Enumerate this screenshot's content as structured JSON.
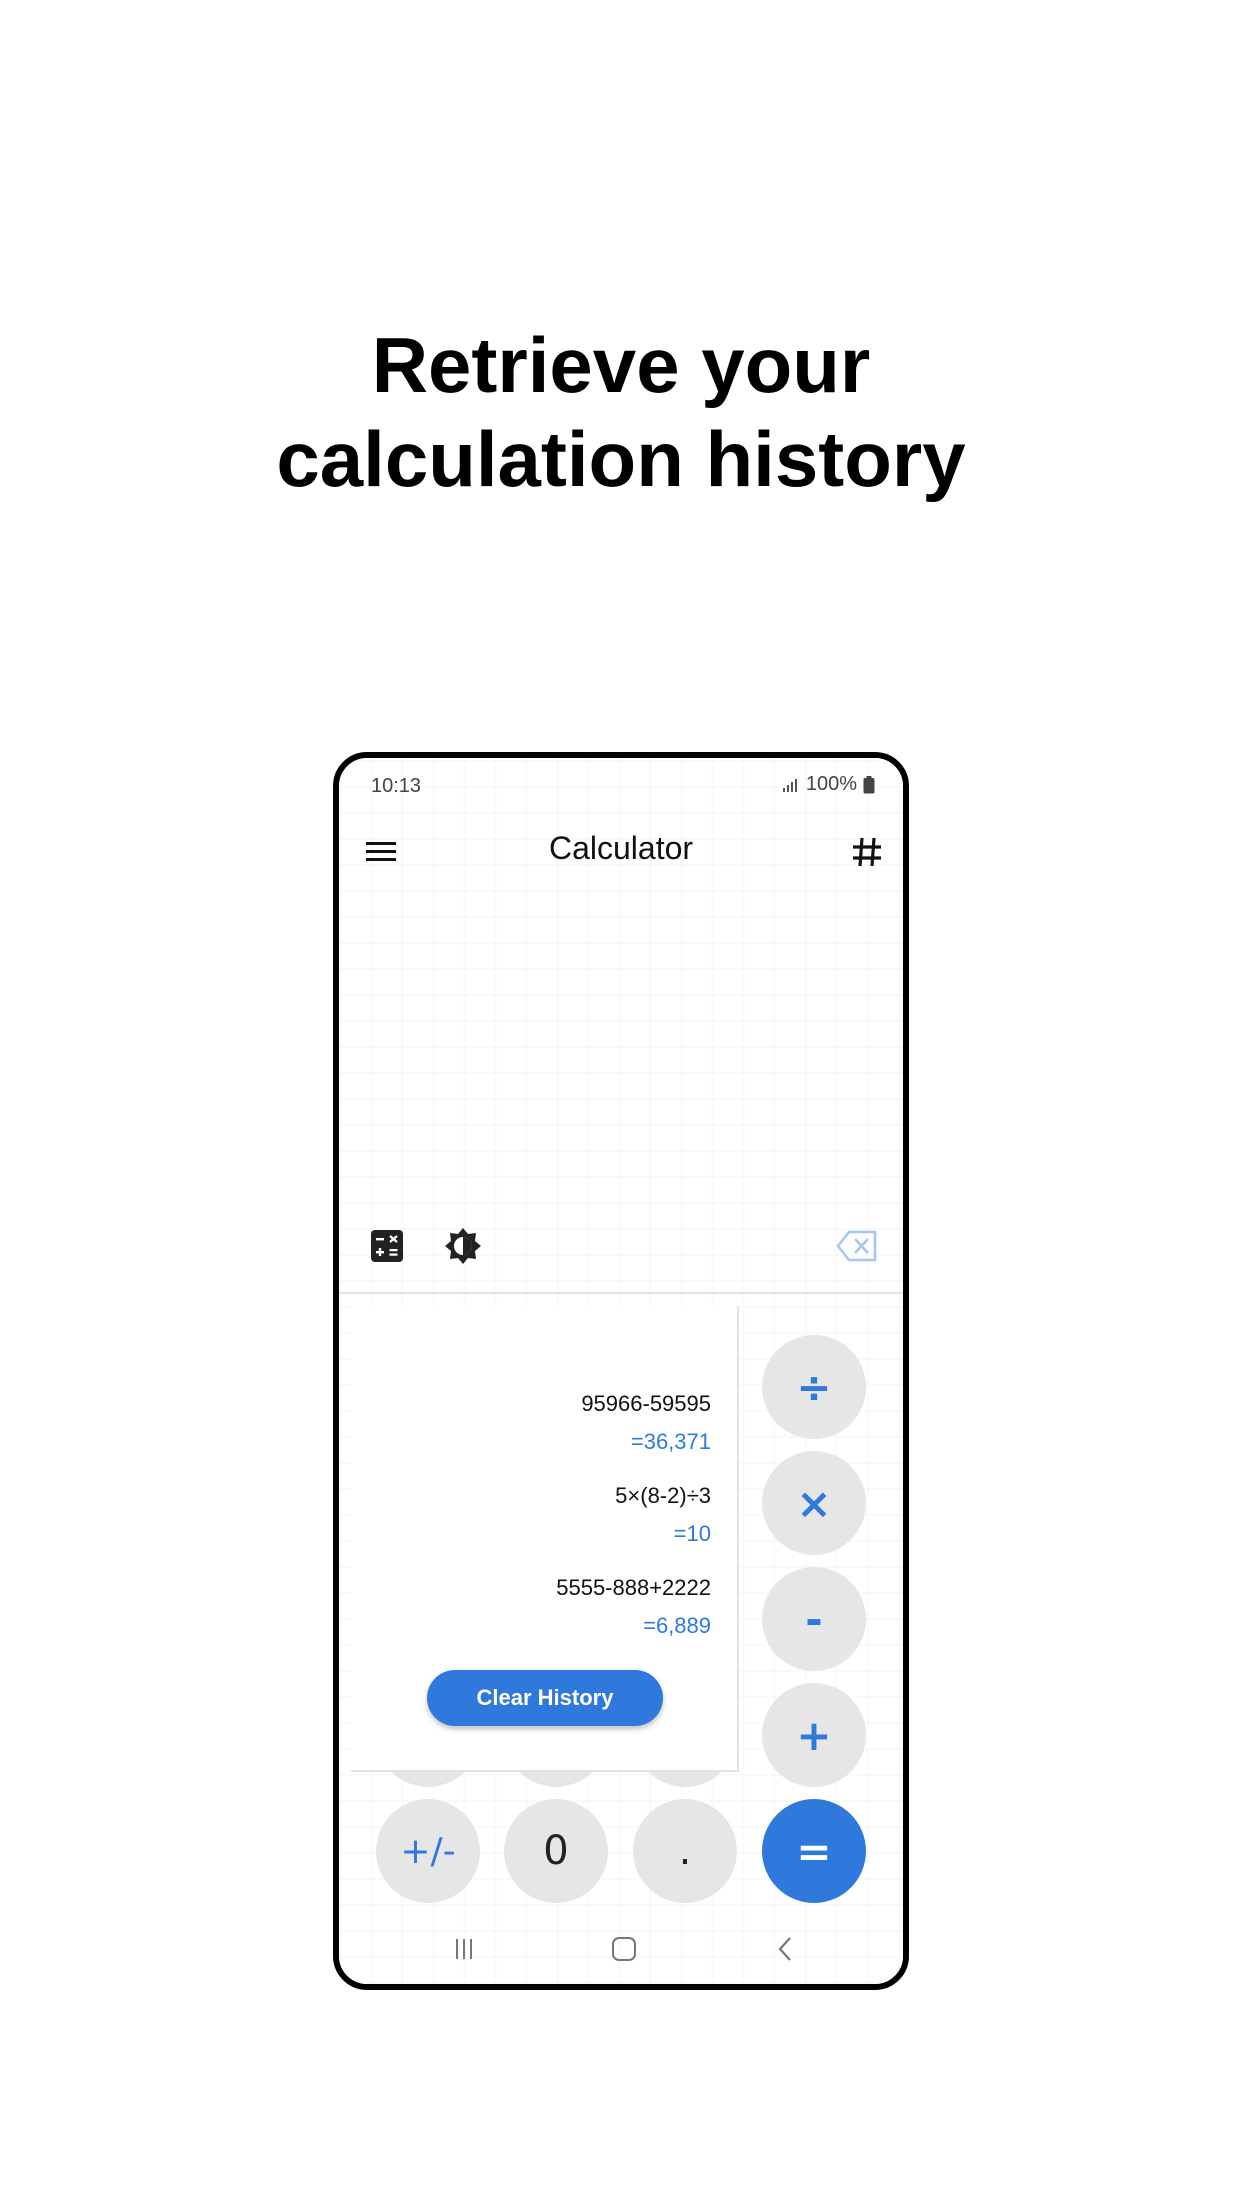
{
  "headline": {
    "line1": "Retrieve your",
    "line2": "calculation history"
  },
  "status_bar": {
    "time": "10:13",
    "battery": "100%"
  },
  "app_bar": {
    "title": "Calculator"
  },
  "keypad": {
    "divide": "÷",
    "multiply": "×",
    "minus": "-",
    "plus": "+",
    "equals": "=",
    "sign": "+/-",
    "zero": "0",
    "decimal": "."
  },
  "history": {
    "items": [
      {
        "expression": "95966-59595",
        "result": "=36,371"
      },
      {
        "expression": "5×(8-2)÷3",
        "result": "=10"
      },
      {
        "expression": "5555-888+2222",
        "result": "=6,889"
      }
    ],
    "clear_label": "Clear History"
  },
  "colors": {
    "accent": "#2f78dc",
    "key_bg": "#e6e6e6"
  },
  "icons": {
    "menu": "menu-icon",
    "grid": "hash-icon",
    "calc_mode": "calculator-toggle-icon",
    "theme": "theme-toggle-icon",
    "backspace": "backspace-icon"
  }
}
